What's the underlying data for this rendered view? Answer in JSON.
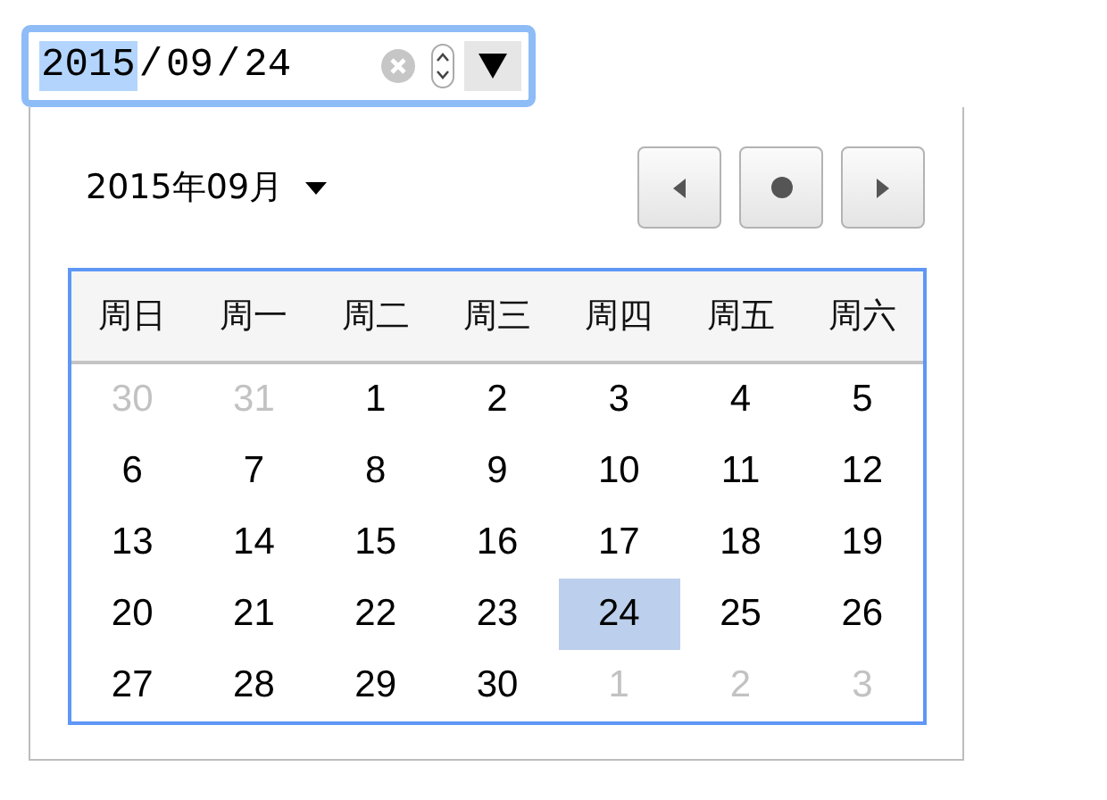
{
  "date_input": {
    "segments": [
      {
        "text": "2015",
        "selected": true
      },
      {
        "text": "/",
        "selected": false
      },
      {
        "text": "09",
        "selected": false
      },
      {
        "text": "/",
        "selected": false
      },
      {
        "text": "24",
        "selected": false
      }
    ],
    "dropdown_open": true
  },
  "picker": {
    "month_label": "2015年09月",
    "weekdays": [
      "周日",
      "周一",
      "周二",
      "周三",
      "周四",
      "周五",
      "周六"
    ],
    "weeks": [
      [
        {
          "day": "30",
          "outside": true,
          "selected": false
        },
        {
          "day": "31",
          "outside": true,
          "selected": false
        },
        {
          "day": "1",
          "outside": false,
          "selected": false
        },
        {
          "day": "2",
          "outside": false,
          "selected": false
        },
        {
          "day": "3",
          "outside": false,
          "selected": false
        },
        {
          "day": "4",
          "outside": false,
          "selected": false
        },
        {
          "day": "5",
          "outside": false,
          "selected": false
        }
      ],
      [
        {
          "day": "6",
          "outside": false,
          "selected": false
        },
        {
          "day": "7",
          "outside": false,
          "selected": false
        },
        {
          "day": "8",
          "outside": false,
          "selected": false
        },
        {
          "day": "9",
          "outside": false,
          "selected": false
        },
        {
          "day": "10",
          "outside": false,
          "selected": false
        },
        {
          "day": "11",
          "outside": false,
          "selected": false
        },
        {
          "day": "12",
          "outside": false,
          "selected": false
        }
      ],
      [
        {
          "day": "13",
          "outside": false,
          "selected": false
        },
        {
          "day": "14",
          "outside": false,
          "selected": false
        },
        {
          "day": "15",
          "outside": false,
          "selected": false
        },
        {
          "day": "16",
          "outside": false,
          "selected": false
        },
        {
          "day": "17",
          "outside": false,
          "selected": false
        },
        {
          "day": "18",
          "outside": false,
          "selected": false
        },
        {
          "day": "19",
          "outside": false,
          "selected": false
        }
      ],
      [
        {
          "day": "20",
          "outside": false,
          "selected": false
        },
        {
          "day": "21",
          "outside": false,
          "selected": false
        },
        {
          "day": "22",
          "outside": false,
          "selected": false
        },
        {
          "day": "23",
          "outside": false,
          "selected": false
        },
        {
          "day": "24",
          "outside": false,
          "selected": true
        },
        {
          "day": "25",
          "outside": false,
          "selected": false
        },
        {
          "day": "26",
          "outside": false,
          "selected": false
        }
      ],
      [
        {
          "day": "27",
          "outside": false,
          "selected": false
        },
        {
          "day": "28",
          "outside": false,
          "selected": false
        },
        {
          "day": "29",
          "outside": false,
          "selected": false
        },
        {
          "day": "30",
          "outside": false,
          "selected": false
        },
        {
          "day": "1",
          "outside": true,
          "selected": false
        },
        {
          "day": "2",
          "outside": true,
          "selected": false
        },
        {
          "day": "3",
          "outside": true,
          "selected": false
        }
      ]
    ]
  }
}
